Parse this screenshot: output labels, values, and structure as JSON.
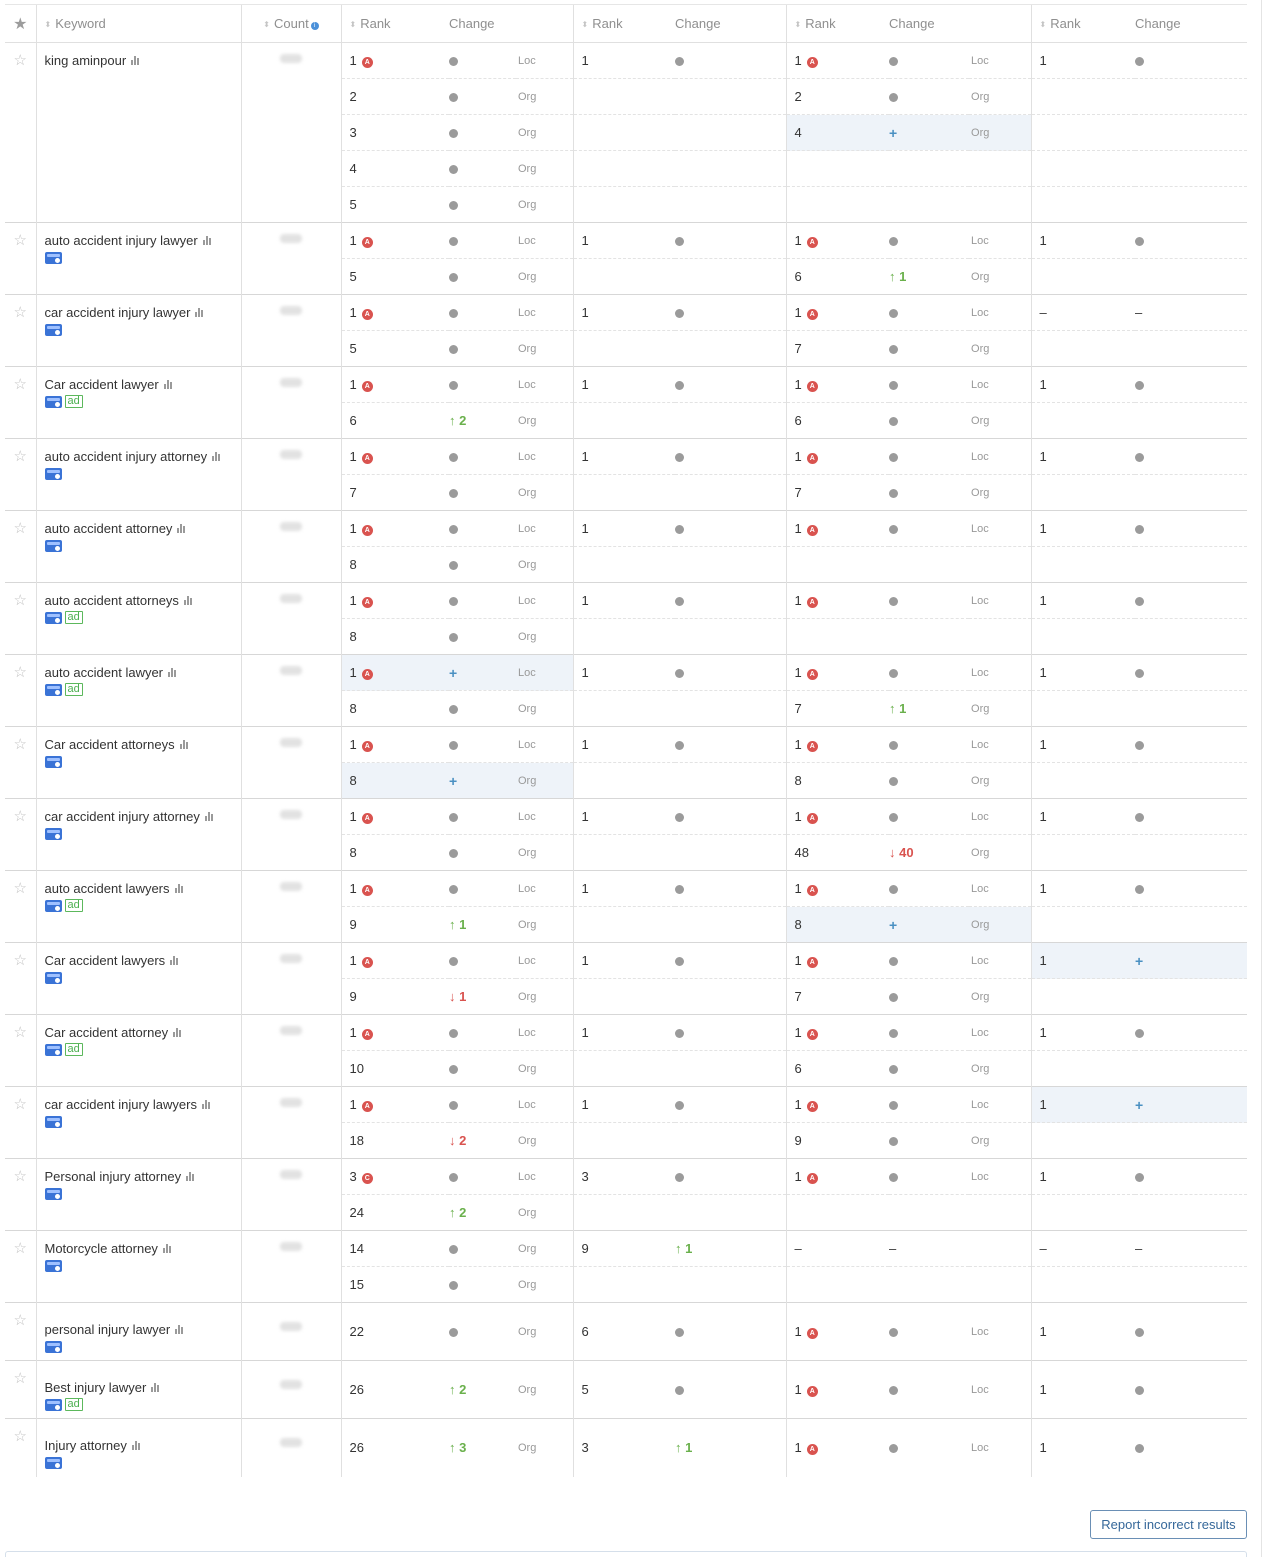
{
  "headers": {
    "keyword": "Keyword",
    "count": "Count",
    "rank": "Rank",
    "change": "Change"
  },
  "labels": {
    "loc": "Loc",
    "org": "Org",
    "ad": "ad",
    "dash": "–"
  },
  "report_button": "Report incorrect results",
  "colors": {
    "up": "#6ab04c",
    "down": "#d9534f",
    "highlight": "#eef3f9",
    "plus": "#4a90c2"
  },
  "keywords": [
    {
      "name": "king aminpour",
      "map": false,
      "ad": false,
      "rows": [
        [
          {
            "r": "1",
            "f": "A",
            "c": "dot",
            "t": "Loc"
          },
          {
            "r": "1",
            "c": "dot"
          },
          {
            "r": "1",
            "f": "A",
            "c": "dot",
            "t": "Loc"
          },
          {
            "r": "1",
            "c": "dot"
          }
        ],
        [
          {
            "r": "2",
            "c": "dot",
            "t": "Org"
          },
          null,
          {
            "r": "2",
            "c": "dot",
            "t": "Org"
          },
          null
        ],
        [
          {
            "r": "3",
            "c": "dot",
            "t": "Org"
          },
          null,
          {
            "r": "4",
            "c": "plus",
            "t": "Org",
            "hl": true
          },
          null
        ],
        [
          {
            "r": "4",
            "c": "dot",
            "t": "Org"
          },
          null,
          null,
          null
        ],
        [
          {
            "r": "5",
            "c": "dot",
            "t": "Org"
          },
          null,
          null,
          null
        ]
      ]
    },
    {
      "name": "auto accident injury lawyer",
      "map": true,
      "ad": false,
      "rows": [
        [
          {
            "r": "1",
            "f": "A",
            "c": "dot",
            "t": "Loc"
          },
          {
            "r": "1",
            "c": "dot"
          },
          {
            "r": "1",
            "f": "A",
            "c": "dot",
            "t": "Loc"
          },
          {
            "r": "1",
            "c": "dot"
          }
        ],
        [
          {
            "r": "5",
            "c": "dot",
            "t": "Org"
          },
          null,
          {
            "r": "6",
            "c": "up",
            "v": "1",
            "t": "Org"
          },
          null
        ]
      ]
    },
    {
      "name": "car accident injury lawyer",
      "map": true,
      "ad": false,
      "rows": [
        [
          {
            "r": "1",
            "f": "A",
            "c": "dot",
            "t": "Loc"
          },
          {
            "r": "1",
            "c": "dot"
          },
          {
            "r": "1",
            "f": "A",
            "c": "dot",
            "t": "Loc"
          },
          {
            "r": "–",
            "c": "dash"
          }
        ],
        [
          {
            "r": "5",
            "c": "dot",
            "t": "Org"
          },
          null,
          {
            "r": "7",
            "c": "dot",
            "t": "Org"
          },
          null
        ]
      ]
    },
    {
      "name": "Car accident lawyer",
      "map": true,
      "ad": true,
      "rows": [
        [
          {
            "r": "1",
            "f": "A",
            "c": "dot",
            "t": "Loc"
          },
          {
            "r": "1",
            "c": "dot"
          },
          {
            "r": "1",
            "f": "A",
            "c": "dot",
            "t": "Loc"
          },
          {
            "r": "1",
            "c": "dot"
          }
        ],
        [
          {
            "r": "6",
            "c": "up",
            "v": "2",
            "t": "Org"
          },
          null,
          {
            "r": "6",
            "c": "dot",
            "t": "Org"
          },
          null
        ]
      ]
    },
    {
      "name": "auto accident injury attorney",
      "map": true,
      "ad": false,
      "rows": [
        [
          {
            "r": "1",
            "f": "A",
            "c": "dot",
            "t": "Loc"
          },
          {
            "r": "1",
            "c": "dot"
          },
          {
            "r": "1",
            "f": "A",
            "c": "dot",
            "t": "Loc"
          },
          {
            "r": "1",
            "c": "dot"
          }
        ],
        [
          {
            "r": "7",
            "c": "dot",
            "t": "Org"
          },
          null,
          {
            "r": "7",
            "c": "dot",
            "t": "Org"
          },
          null
        ]
      ]
    },
    {
      "name": "auto accident attorney",
      "map": true,
      "ad": false,
      "rows": [
        [
          {
            "r": "1",
            "f": "A",
            "c": "dot",
            "t": "Loc"
          },
          {
            "r": "1",
            "c": "dot"
          },
          {
            "r": "1",
            "f": "A",
            "c": "dot",
            "t": "Loc"
          },
          {
            "r": "1",
            "c": "dot"
          }
        ],
        [
          {
            "r": "8",
            "c": "dot",
            "t": "Org"
          },
          null,
          null,
          null
        ]
      ]
    },
    {
      "name": "auto accident attorneys",
      "map": true,
      "ad": true,
      "rows": [
        [
          {
            "r": "1",
            "f": "A",
            "c": "dot",
            "t": "Loc"
          },
          {
            "r": "1",
            "c": "dot"
          },
          {
            "r": "1",
            "f": "A",
            "c": "dot",
            "t": "Loc"
          },
          {
            "r": "1",
            "c": "dot"
          }
        ],
        [
          {
            "r": "8",
            "c": "dot",
            "t": "Org"
          },
          null,
          null,
          null
        ]
      ]
    },
    {
      "name": "auto accident lawyer",
      "map": true,
      "ad": true,
      "rows": [
        [
          {
            "r": "1",
            "f": "A",
            "c": "plus",
            "t": "Loc",
            "hl": true
          },
          {
            "r": "1",
            "c": "dot"
          },
          {
            "r": "1",
            "f": "A",
            "c": "dot",
            "t": "Loc"
          },
          {
            "r": "1",
            "c": "dot"
          }
        ],
        [
          {
            "r": "8",
            "c": "dot",
            "t": "Org"
          },
          null,
          {
            "r": "7",
            "c": "up",
            "v": "1",
            "t": "Org"
          },
          null
        ]
      ]
    },
    {
      "name": "Car accident attorneys",
      "map": true,
      "ad": false,
      "rows": [
        [
          {
            "r": "1",
            "f": "A",
            "c": "dot",
            "t": "Loc"
          },
          {
            "r": "1",
            "c": "dot"
          },
          {
            "r": "1",
            "f": "A",
            "c": "dot",
            "t": "Loc"
          },
          {
            "r": "1",
            "c": "dot"
          }
        ],
        [
          {
            "r": "8",
            "c": "plus",
            "t": "Org",
            "hl": true
          },
          null,
          {
            "r": "8",
            "c": "dot",
            "t": "Org"
          },
          null
        ]
      ]
    },
    {
      "name": "car accident injury attorney",
      "map": true,
      "ad": false,
      "rows": [
        [
          {
            "r": "1",
            "f": "A",
            "c": "dot",
            "t": "Loc"
          },
          {
            "r": "1",
            "c": "dot"
          },
          {
            "r": "1",
            "f": "A",
            "c": "dot",
            "t": "Loc"
          },
          {
            "r": "1",
            "c": "dot"
          }
        ],
        [
          {
            "r": "8",
            "c": "dot",
            "t": "Org"
          },
          null,
          {
            "r": "48",
            "c": "down",
            "v": "40",
            "t": "Org"
          },
          null
        ]
      ]
    },
    {
      "name": "auto accident lawyers",
      "map": true,
      "ad": true,
      "rows": [
        [
          {
            "r": "1",
            "f": "A",
            "c": "dot",
            "t": "Loc"
          },
          {
            "r": "1",
            "c": "dot"
          },
          {
            "r": "1",
            "f": "A",
            "c": "dot",
            "t": "Loc"
          },
          {
            "r": "1",
            "c": "dot"
          }
        ],
        [
          {
            "r": "9",
            "c": "up",
            "v": "1",
            "t": "Org"
          },
          null,
          {
            "r": "8",
            "c": "plus",
            "t": "Org",
            "hl": true
          },
          null
        ]
      ]
    },
    {
      "name": "Car accident lawyers",
      "map": true,
      "ad": false,
      "rows": [
        [
          {
            "r": "1",
            "f": "A",
            "c": "dot",
            "t": "Loc"
          },
          {
            "r": "1",
            "c": "dot"
          },
          {
            "r": "1",
            "f": "A",
            "c": "dot",
            "t": "Loc"
          },
          {
            "r": "1",
            "c": "plus",
            "hl": true
          }
        ],
        [
          {
            "r": "9",
            "c": "down",
            "v": "1",
            "t": "Org"
          },
          null,
          {
            "r": "7",
            "c": "dot",
            "t": "Org"
          },
          null
        ]
      ]
    },
    {
      "name": "Car accident attorney",
      "map": true,
      "ad": true,
      "rows": [
        [
          {
            "r": "1",
            "f": "A",
            "c": "dot",
            "t": "Loc"
          },
          {
            "r": "1",
            "c": "dot"
          },
          {
            "r": "1",
            "f": "A",
            "c": "dot",
            "t": "Loc"
          },
          {
            "r": "1",
            "c": "dot"
          }
        ],
        [
          {
            "r": "10",
            "c": "dot",
            "t": "Org"
          },
          null,
          {
            "r": "6",
            "c": "dot",
            "t": "Org"
          },
          null
        ]
      ]
    },
    {
      "name": "car accident injury lawyers",
      "map": true,
      "ad": false,
      "rows": [
        [
          {
            "r": "1",
            "f": "A",
            "c": "dot",
            "t": "Loc"
          },
          {
            "r": "1",
            "c": "dot"
          },
          {
            "r": "1",
            "f": "A",
            "c": "dot",
            "t": "Loc"
          },
          {
            "r": "1",
            "c": "plus",
            "hl": true
          }
        ],
        [
          {
            "r": "18",
            "c": "down",
            "v": "2",
            "t": "Org"
          },
          null,
          {
            "r": "9",
            "c": "dot",
            "t": "Org"
          },
          null
        ]
      ]
    },
    {
      "name": "Personal injury attorney",
      "map": true,
      "ad": false,
      "rows": [
        [
          {
            "r": "3",
            "f": "C",
            "c": "dot",
            "t": "Loc"
          },
          {
            "r": "3",
            "c": "dot"
          },
          {
            "r": "1",
            "f": "A",
            "c": "dot",
            "t": "Loc"
          },
          {
            "r": "1",
            "c": "dot"
          }
        ],
        [
          {
            "r": "24",
            "c": "up",
            "v": "2",
            "t": "Org"
          },
          null,
          null,
          null
        ]
      ]
    },
    {
      "name": "Motorcycle attorney",
      "map": true,
      "ad": false,
      "rows": [
        [
          {
            "r": "14",
            "c": "dot",
            "t": "Org"
          },
          {
            "r": "9",
            "c": "up",
            "v": "1"
          },
          {
            "r": "–",
            "c": "dash"
          },
          {
            "r": "–",
            "c": "dash"
          }
        ],
        [
          {
            "r": "15",
            "c": "dot",
            "t": "Org"
          },
          null,
          null,
          null
        ]
      ]
    },
    {
      "name": "personal injury lawyer",
      "map": true,
      "ad": false,
      "single": true,
      "rows": [
        [
          {
            "r": "22",
            "c": "dot",
            "t": "Org"
          },
          {
            "r": "6",
            "c": "dot"
          },
          {
            "r": "1",
            "f": "A",
            "c": "dot",
            "t": "Loc"
          },
          {
            "r": "1",
            "c": "dot"
          }
        ]
      ]
    },
    {
      "name": "Best injury lawyer",
      "map": true,
      "ad": true,
      "single": true,
      "rows": [
        [
          {
            "r": "26",
            "c": "up",
            "v": "2",
            "t": "Org"
          },
          {
            "r": "5",
            "c": "dot"
          },
          {
            "r": "1",
            "f": "A",
            "c": "dot",
            "t": "Loc"
          },
          {
            "r": "1",
            "c": "dot"
          }
        ]
      ]
    },
    {
      "name": "Injury attorney",
      "map": true,
      "ad": false,
      "single": true,
      "rows": [
        [
          {
            "r": "26",
            "c": "up",
            "v": "3",
            "t": "Org"
          },
          {
            "r": "3",
            "c": "up",
            "v": "1"
          },
          {
            "r": "1",
            "f": "A",
            "c": "dot",
            "t": "Loc"
          },
          {
            "r": "1",
            "c": "dot"
          }
        ]
      ]
    }
  ]
}
